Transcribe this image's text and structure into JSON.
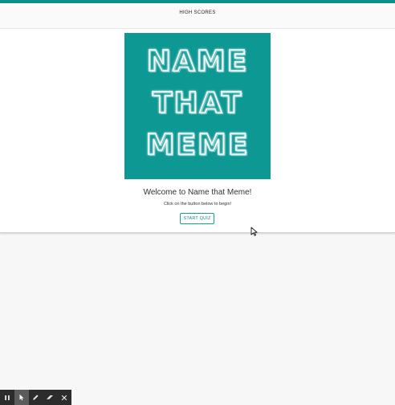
{
  "header": {
    "nav_link": "HIGH SCORES",
    "accent_color": "#0c8f8b"
  },
  "hero": {
    "logo_lines": [
      "NAME",
      "THAT",
      "MEME"
    ],
    "logo_background": "#0d9894"
  },
  "welcome": {
    "title": "Welcome to Name that Meme!",
    "instruction": "Click on the button below to begin!",
    "start_button": "START QUIZ"
  },
  "toolbar": {
    "tools": [
      "pause-icon",
      "pointer-icon",
      "pen-icon",
      "eraser-icon",
      "close-icon"
    ],
    "active_tool": "pointer-icon"
  }
}
